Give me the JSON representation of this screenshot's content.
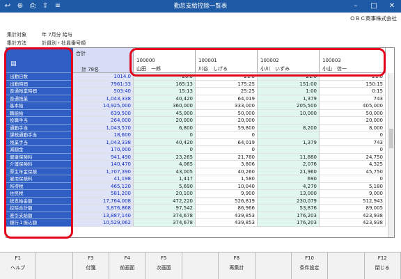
{
  "window": {
    "title": "勤怠支給控除一覧表"
  },
  "company": "ＯＢＣ商事株式会社",
  "info": {
    "target_label": "集計対象",
    "target_value": "年 7月分 給与",
    "method_label": "集計方法",
    "method_value": "計員別・社員番号順"
  },
  "total": {
    "label": "合計",
    "count": "計 78名"
  },
  "employees": [
    {
      "code": "100000",
      "name": "山田　一郎"
    },
    {
      "code": "100001",
      "name": "川谷　しげる"
    },
    {
      "code": "100002",
      "name": "小川　いずみ"
    },
    {
      "code": "100003",
      "name": "小山　信一"
    }
  ],
  "rows": [
    {
      "label": "出勤日数",
      "total": "1014.0",
      "vals": [
        "20.0",
        "21.0",
        "21.0",
        "21.0"
      ]
    },
    {
      "label": "出勤時間",
      "total": "7961:33",
      "vals": [
        "165:13",
        "175:25",
        "151:00",
        "150:15"
      ]
    },
    {
      "label": "普通残業時間",
      "total": "503:40",
      "vals": [
        "15:13",
        "25:25",
        "1:00",
        "0:15"
      ]
    },
    {
      "label": "普通残業",
      "total": "1,043,338",
      "vals": [
        "40,420",
        "64,019",
        "1,379",
        "743"
      ]
    },
    {
      "label": "基本給",
      "total": "14,925,000",
      "vals": [
        "360,000",
        "333,000",
        "205,500",
        "405,000"
      ]
    },
    {
      "label": "職能給",
      "total": "639,500",
      "vals": [
        "45,000",
        "50,000",
        "10,000",
        "50,000"
      ]
    },
    {
      "label": "役職手当",
      "total": "264,000",
      "vals": [
        "20,000",
        "20,000",
        "",
        "20,000"
      ]
    },
    {
      "label": "通勤手当",
      "total": "1,043,570",
      "vals": [
        "6,800",
        "59,800",
        "8,200",
        "8,000"
      ]
    },
    {
      "label": "課税通勤手当",
      "total": "18,600",
      "vals": [
        "0",
        "0",
        "",
        "0"
      ]
    },
    {
      "label": "残業手当",
      "total": "1,043,338",
      "vals": [
        "40,420",
        "64,019",
        "1,379",
        "743"
      ]
    },
    {
      "label": "減額金",
      "total": "170,000",
      "vals": [
        "0",
        "0",
        "",
        "0"
      ]
    },
    {
      "label": "健康保険料",
      "total": "941,490",
      "vals": [
        "23,265",
        "21,780",
        "11,880",
        "24,750"
      ]
    },
    {
      "label": "介護保険料",
      "total": "140,470",
      "vals": [
        "4,065",
        "3,806",
        "2,076",
        "4,325"
      ]
    },
    {
      "label": "厚生年金保険",
      "total": "1,707,390",
      "vals": [
        "43,005",
        "40,260",
        "21,960",
        "45,750"
      ]
    },
    {
      "label": "雇用保険料",
      "total": "41,198",
      "vals": [
        "1,417",
        "1,580",
        "690",
        "0"
      ]
    },
    {
      "label": "所得税",
      "total": "465,120",
      "vals": [
        "5,690",
        "10,040",
        "4,270",
        "5,180"
      ]
    },
    {
      "label": "住民税",
      "total": "581,200",
      "vals": [
        "20,100",
        "9,900",
        "13,000",
        "9,000"
      ]
    },
    {
      "label": "総支給金額",
      "total": "17,764,008",
      "vals": [
        "472,220",
        "526,819",
        "230,079",
        "512,943"
      ]
    },
    {
      "label": "控除合計額",
      "total": "3,876,868",
      "vals": [
        "97,542",
        "86,966",
        "53,876",
        "89,005"
      ]
    },
    {
      "label": "差引支給額",
      "total": "13,887,140",
      "vals": [
        "374,678",
        "439,853",
        "176,203",
        "423,938"
      ]
    },
    {
      "label": "銀行１振込額",
      "total": "10,529,062",
      "vals": [
        "374,678",
        "439,853",
        "176,203",
        "423,938"
      ]
    }
  ],
  "fkeys": [
    {
      "key": "F1",
      "label": "ヘルプ"
    },
    {
      "key": "",
      "label": ""
    },
    {
      "key": "F3",
      "label": "付箋"
    },
    {
      "key": "F4",
      "label": "前画面"
    },
    {
      "key": "F5",
      "label": "次画面"
    },
    {
      "key": "",
      "label": ""
    },
    {
      "key": "F8",
      "label": "再集計"
    },
    {
      "key": "",
      "label": ""
    },
    {
      "key": "F10",
      "label": "条件設定"
    },
    {
      "key": "",
      "label": ""
    },
    {
      "key": "F12",
      "label": "閉じる"
    }
  ]
}
